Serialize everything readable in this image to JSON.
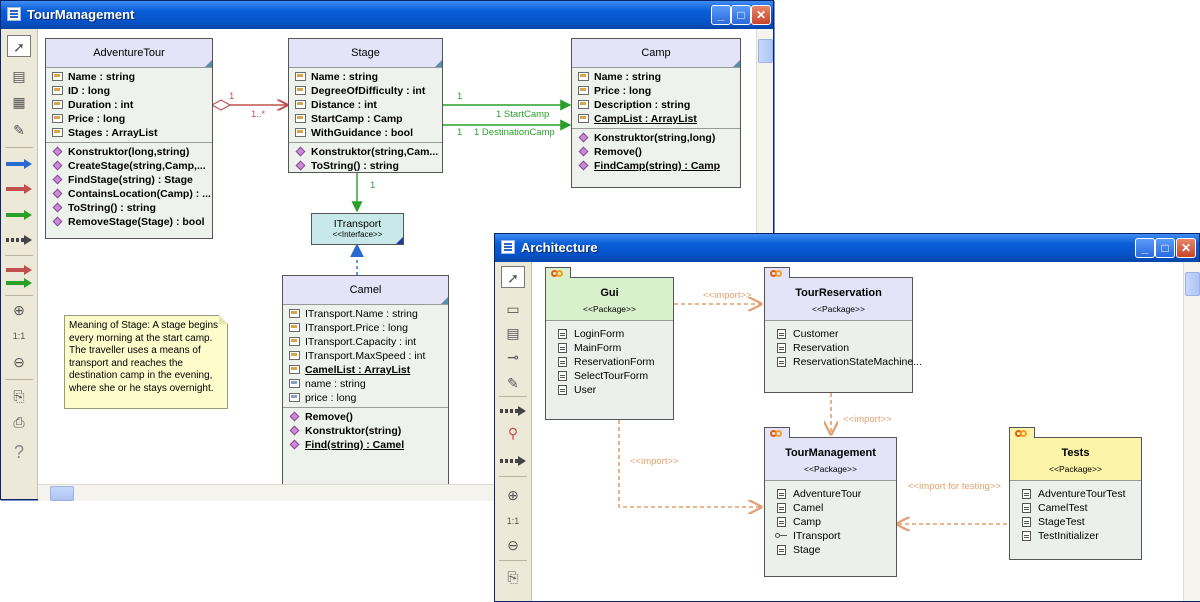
{
  "tour_window": {
    "title": "TourManagement",
    "classes": {
      "adventure_tour": {
        "name": "AdventureTour",
        "attributes": [
          "Name : string",
          "ID : long",
          "Duration : int",
          "Price : long",
          "Stages : ArrayList"
        ],
        "operations": [
          "Konstruktor(long,string)",
          "CreateStage(string,Camp,...",
          "FindStage(string) : Stage",
          "ContainsLocation(Camp) : ...",
          "ToString() : string",
          "RemoveStage(Stage) : bool"
        ]
      },
      "stage": {
        "name": "Stage",
        "attributes": [
          "Name : string",
          "DegreeOfDifficulty : int",
          "Distance : int",
          "StartCamp : Camp",
          "WithGuidance : bool"
        ],
        "operations": [
          "Konstruktor(string,Cam...",
          "ToString() : string"
        ]
      },
      "camp": {
        "name": "Camp",
        "attributes": [
          "Name : string",
          "Price : long",
          "Description : string",
          "CampList : ArrayList"
        ],
        "operations": [
          "Konstruktor(string,long)",
          "Remove()",
          "FindCamp(string) : Camp"
        ]
      },
      "camel": {
        "name": "Camel",
        "attributes": [
          "ITransport.Name : string",
          "ITransport.Price : long",
          "ITransport.Capacity : int",
          "ITransport.MaxSpeed : int",
          "CamelList : ArrayList",
          "name : string",
          "price : long"
        ],
        "operations": [
          "Remove()",
          "Konstruktor(string)",
          "Find(string) : Camel"
        ]
      }
    },
    "interface": {
      "name": "ITransport",
      "stereotype": "<<Interface>>"
    },
    "note": "Meaning of Stage: A stage begins every morning at the start camp. The traveller uses a means of transport and reaches the destination camp in the evening, where she or he stays overnight.",
    "labels": {
      "agg_one": "1",
      "agg_many": "1..*",
      "start_mult": "1",
      "start_role": "1 StartCamp",
      "dest_mult": "1",
      "dest_role": "1 DestinationCamp",
      "transport_mult": "1"
    },
    "tool_labels": {
      "zoom_reset": "1:1",
      "help": "?"
    }
  },
  "arch_window": {
    "title": "Architecture",
    "packages": {
      "gui": {
        "name": "Gui",
        "stereotype": "<<Package>>",
        "items": [
          "LoginForm",
          "MainForm",
          "ReservationForm",
          "SelectTourForm",
          "User"
        ]
      },
      "tour_reservation": {
        "name": "TourReservation",
        "stereotype": "<<Package>>",
        "items": [
          "Customer",
          "Reservation",
          "ReservationStateMachine..."
        ]
      },
      "tour_management": {
        "name": "TourManagement",
        "stereotype": "<<Package>>",
        "items": [
          "AdventureTour",
          "Camel",
          "Camp",
          "ITransport",
          "Stage"
        ]
      },
      "tests": {
        "name": "Tests",
        "stereotype": "<<Package>>",
        "items": [
          "AdventureTourTest",
          "CamelTest",
          "StageTest",
          "TestInitializer"
        ]
      }
    },
    "labels": {
      "import_gui_res": "<<import>>",
      "import_res_tm": "<<import>>",
      "import_gui_tm": "<<import>>",
      "import_testing": "<<import for testing>>"
    },
    "tool_labels": {
      "zoom_reset": "1:1"
    }
  },
  "colors": {
    "aggregation": "#c0504d",
    "association": "#2aa02a",
    "realization": "#2a6ad0",
    "import": "#e0a070",
    "titlebar": "#0a5fd6",
    "gui_package": "#d8f0cc",
    "tests_package": "#fbf4a8",
    "package_header": "#e4e3f8"
  }
}
